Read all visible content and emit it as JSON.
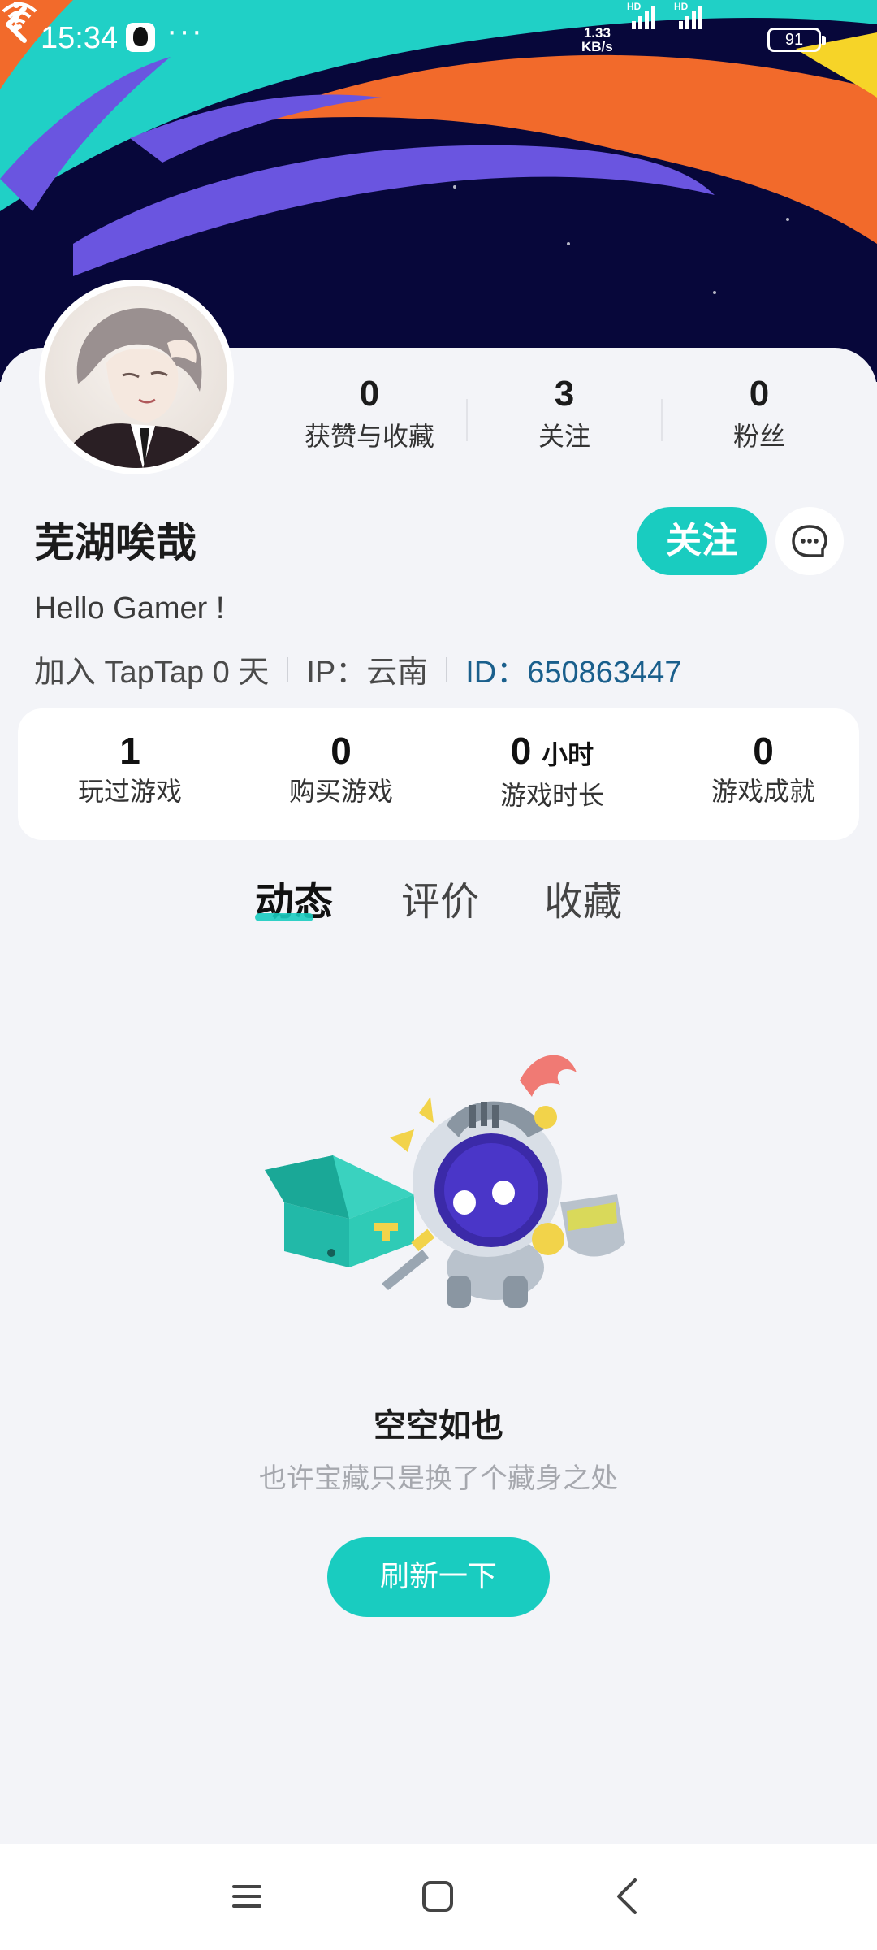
{
  "status_bar": {
    "time": "15:34",
    "dots": "···",
    "speed_value": "1.33",
    "speed_unit": "KB/s",
    "battery": "91",
    "icons": [
      "qq-icon",
      "signal-hd-icon",
      "signal-hd-icon",
      "wifi-icon",
      "battery-icon"
    ]
  },
  "header": {
    "back_icon": "chevron-left-icon",
    "more_icon": "more-vertical-icon"
  },
  "profile": {
    "username": "芜湖唉哉",
    "bio": "Hello Gamer !",
    "join_text": "加入 TapTap 0 天",
    "ip_text": "IP：云南",
    "id_text": "ID：650863447",
    "follow_label": "关注",
    "message_icon": "chat-bubble-icon"
  },
  "top_stats": [
    {
      "value": "0",
      "label": "获赞与收藏"
    },
    {
      "value": "3",
      "label": "关注"
    },
    {
      "value": "0",
      "label": "粉丝"
    }
  ],
  "game_stats": [
    {
      "value": "1",
      "unit": "",
      "label": "玩过游戏"
    },
    {
      "value": "0",
      "unit": "",
      "label": "购买游戏"
    },
    {
      "value": "0",
      "unit": "小时",
      "label": "游戏时长"
    },
    {
      "value": "0",
      "unit": "",
      "label": "游戏成就"
    }
  ],
  "tabs": [
    {
      "label": "动态",
      "active": true
    },
    {
      "label": "评价",
      "active": false
    },
    {
      "label": "收藏",
      "active": false
    }
  ],
  "empty_state": {
    "title": "空空如也",
    "subtitle": "也许宝藏只是换了个藏身之处",
    "button_label": "刷新一下"
  },
  "colors": {
    "accent": "#19ccc0",
    "id_link": "#1a5f8c",
    "banner_bg": "#07073a"
  },
  "nav_bar": {
    "icons": [
      "menu-icon",
      "home-square-icon",
      "back-triangle-icon"
    ]
  }
}
